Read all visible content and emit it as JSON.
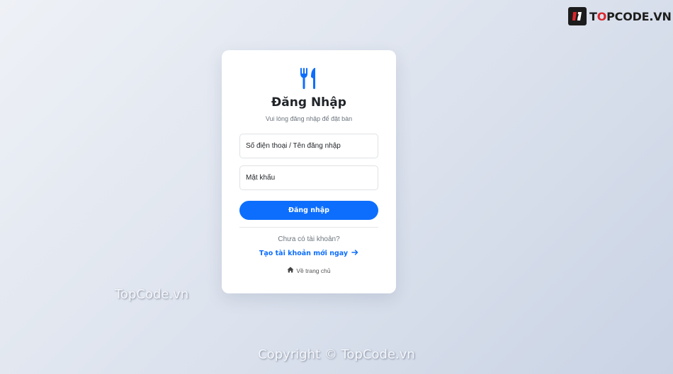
{
  "brand": {
    "prefix": "T",
    "accent": "O",
    "rest": "PCODE.VN"
  },
  "login": {
    "title": "Đăng Nhập",
    "subtitle": "Vui lòng đăng nhập để đặt bàn",
    "username_placeholder": "Số điện thoại / Tên đăng nhập",
    "username_value": "",
    "password_placeholder": "Mật khẩu",
    "password_value": "",
    "submit_label": "Đăng nhập",
    "no_account_text": "Chưa có tài khoản?",
    "create_account_label": "Tạo tài khoản mới ngay",
    "home_label": "Về trang chủ",
    "icon": "utensils-icon"
  },
  "watermarks": {
    "left": "TopCode.vn",
    "bottom": "Copyright © TopCode.vn"
  },
  "colors": {
    "primary": "#0d6efd",
    "brand_accent": "#d9262c",
    "brand_dark": "#1c1c1c"
  }
}
